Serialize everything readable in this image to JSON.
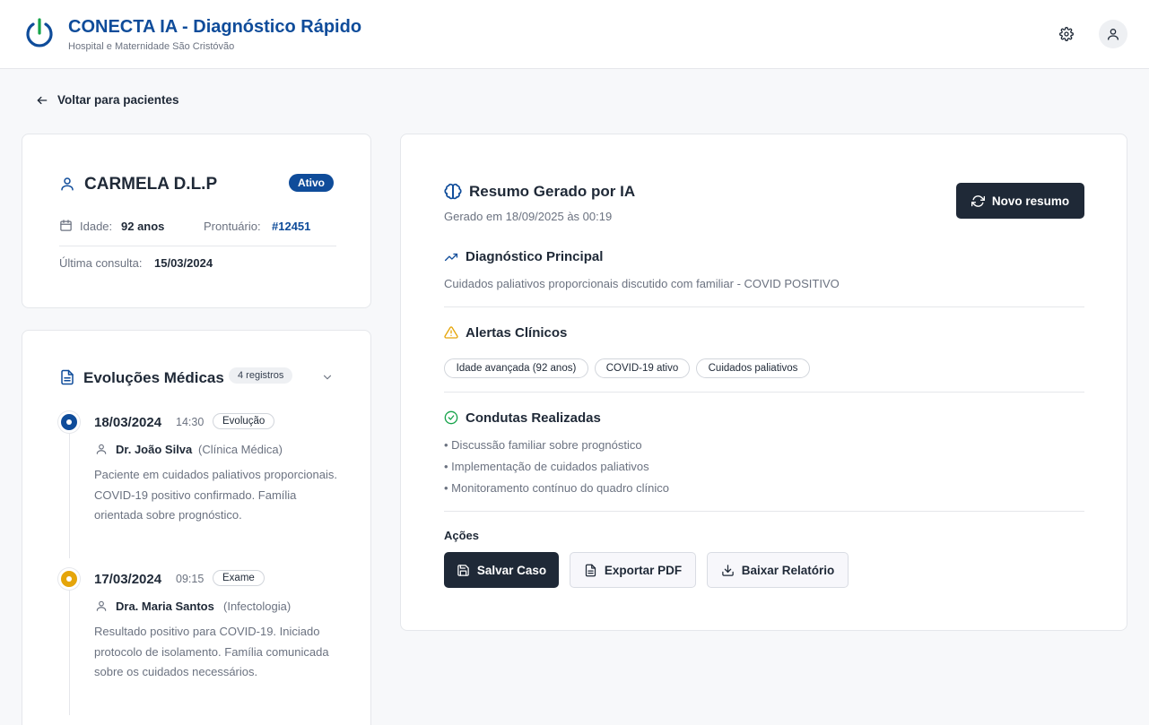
{
  "header": {
    "title": "CONECTA IA - Diagnóstico Rápido",
    "subtitle": "Hospital e Maternidade São Cristóvão",
    "icons": [
      "power-logo-icon",
      "gear-icon",
      "user-icon"
    ]
  },
  "back_link": "Voltar para pacientes",
  "patient": {
    "name": "CARMELA D.L.P",
    "status": "Ativo",
    "age_label": "Idade:",
    "age_value": "92 anos",
    "record_label": "Prontuário:",
    "record_value": "#12451",
    "last_visit_label": "Última consulta:",
    "last_visit_value": "15/03/2024"
  },
  "evolutions": {
    "title": "Evoluções Médicas",
    "count": "4 registros",
    "items": [
      {
        "date": "18/03/2024",
        "time": "14:30",
        "type": "Evolução",
        "doctor": "Dr. João Silva",
        "specialty": "(Clínica Médica)",
        "text": "Paciente em cuidados paliativos proporcionais. COVID-19 positivo confirmado. Família orientada sobre prognóstico.",
        "color": "#0f4c9a"
      },
      {
        "date": "17/03/2024",
        "time": "09:15",
        "type": "Exame",
        "doctor": "Dra. Maria Santos",
        "specialty": "(Infectologia)",
        "text": "Resultado positivo para COVID-19. Iniciado protocolo de isolamento. Família comunicada sobre os cuidados necessários.",
        "color": "#e5a50a"
      }
    ]
  },
  "summary": {
    "title": "Resumo Gerado por IA",
    "generated": "Gerado em 18/09/2025 às 00:19",
    "new_button": "Novo resumo",
    "diagnosis_title": "Diagnóstico Principal",
    "diagnosis_text": "Cuidados paliativos proporcionais discutido com familiar - COVID POSITIVO",
    "alerts_title": "Alertas Clínicos",
    "alerts": [
      "Idade avançada (92 anos)",
      "COVID-19 ativo",
      "Cuidados paliativos"
    ],
    "conducts_title": "Condutas Realizadas",
    "conducts": [
      "• Discussão familiar sobre prognóstico",
      "• Implementação de cuidados paliativos",
      "• Monitoramento contínuo do quadro clínico"
    ],
    "actions_title": "Ações",
    "actions": {
      "save": "Salvar Caso",
      "export": "Exportar PDF",
      "download": "Baixar Relatório"
    }
  },
  "colors": {
    "brand": "#0f4c9a",
    "dark_button": "#1f2937",
    "alert": "#e5a50a",
    "success": "#16a34a"
  }
}
